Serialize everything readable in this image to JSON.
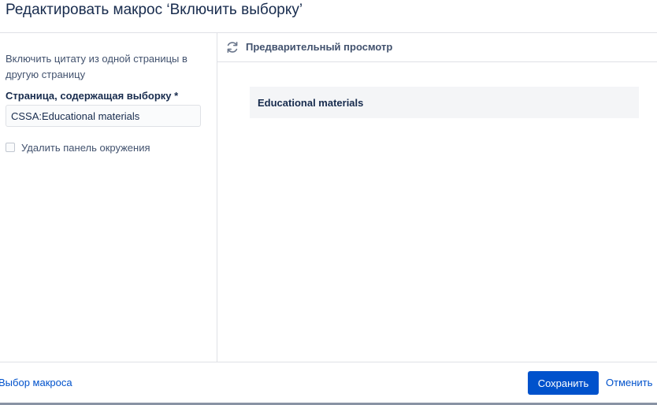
{
  "dialog": {
    "title": "Редактировать макрос ‘Включить выборку’"
  },
  "left_panel": {
    "description": "Включить цитату из одной страницы в другую страницу",
    "page_field_label": "Страница, содержащая выборку *",
    "page_field_value": "CSSA:Educational materials",
    "hide_panel_checked": false,
    "hide_panel_label": "Удалить панель окружения"
  },
  "preview": {
    "refresh_icon": "refresh-icon",
    "title": "Предварительный просмотр",
    "excerpt_title": "Educational materials"
  },
  "footer": {
    "select_macro_label": "Выбор макроса",
    "save_label": "Сохранить",
    "cancel_label": "Отменить"
  },
  "colors": {
    "primary": "#0052cc",
    "text": "#172b4d",
    "subtle_text": "#42526e",
    "border": "#dfe1e6",
    "excerpt_bg": "#f4f5f7"
  }
}
